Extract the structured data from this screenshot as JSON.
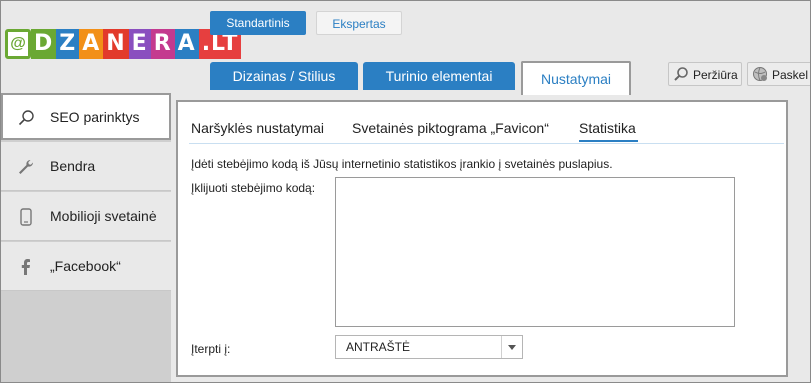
{
  "logo": {
    "letters": [
      "D",
      "Z",
      "A",
      "N",
      "E",
      "R",
      "A",
      ".LT"
    ],
    "colors": [
      "#6aa833",
      "#2b7fc3",
      "#f29018",
      "#e23a2b",
      "#8a4fbf",
      "#c43a8f",
      "#2b7fc3",
      "#e63f3f"
    ]
  },
  "mode": {
    "standard": "Standartinis",
    "expert": "Ekspertas"
  },
  "tabs": {
    "design": "Dizainas / Stilius",
    "content": "Turinio elementai",
    "settings": "Nustatymai"
  },
  "toolbar": {
    "preview": "Peržiūra",
    "publish": "Paskel"
  },
  "sidebar": {
    "items": [
      {
        "label": "SEO parinktys",
        "icon": "search-icon"
      },
      {
        "label": "Bendra",
        "icon": "wrench-icon"
      },
      {
        "label": "Mobilioji svetainė",
        "icon": "mobile-icon"
      },
      {
        "label": "„Facebook“",
        "icon": "facebook-icon"
      }
    ]
  },
  "subtabs": {
    "browser": "Naršyklės nustatymai",
    "favicon": "Svetainės piktograma „Favicon“",
    "stats": "Statistika"
  },
  "stats": {
    "description": "Įdėti stebėjimo kodą iš Jūsų internetinio statistikos įrankio į svetainės puslapius.",
    "paste_label": "Įklijuoti stebėjimo kodą:",
    "code_value": "",
    "insert_label": "Įterpti į:",
    "insert_selected": "ANTRAŠTĖ"
  },
  "colors": {
    "accent": "#2b7fc3",
    "active_border": "#9a9a9a"
  }
}
